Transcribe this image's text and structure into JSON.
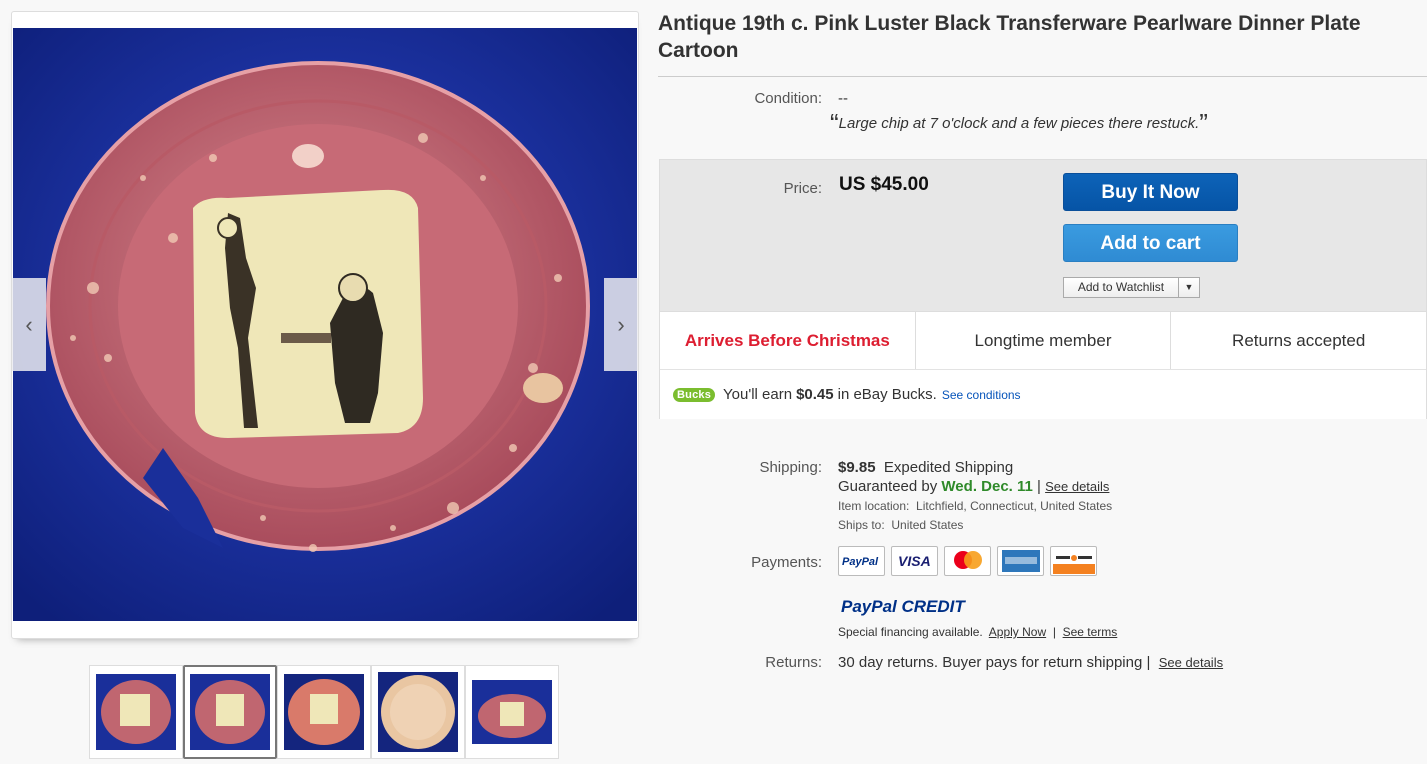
{
  "listing": {
    "title": "Antique 19th c. Pink Luster Black Transferware Pearlware Dinner Plate Cartoon"
  },
  "viewer": {
    "prev_arrow": "‹",
    "next_arrow": "›",
    "thumbnail_count": 5,
    "active_thumbnail": 2
  },
  "condition": {
    "label": "Condition:",
    "value": "--",
    "quote_open": "“",
    "note": "Large chip at 7 o'clock and a few pieces there restuck.",
    "quote_close": "”"
  },
  "buybox": {
    "price_label": "Price:",
    "price": "US $45.00",
    "buy_now": "Buy It Now",
    "add_to_cart": "Add to cart",
    "watchlist": "Add to Watchlist",
    "watchlist_arrow": "▼"
  },
  "badges": {
    "arrives": "Arrives Before Christmas",
    "member": "Longtime member",
    "returns": "Returns accepted"
  },
  "bucks": {
    "logo": "Bucks",
    "prefix": "You'll earn",
    "amount": "$0.45",
    "suffix": "in eBay Bucks.",
    "link": "See conditions"
  },
  "shipping": {
    "label": "Shipping:",
    "cost": "$9.85",
    "method": "Expedited Shipping",
    "guaranteed_prefix": "Guaranteed by",
    "guaranteed_date": "Wed. Dec. 11",
    "separator": "|",
    "details_link": "See details",
    "location_label": "Item location:",
    "location": "Litchfield, Connecticut, United States",
    "ships_to_label": "Ships to:",
    "ships_to": "United States"
  },
  "payments": {
    "label": "Payments:",
    "cards": [
      "PayPal",
      "VISA",
      "Mastercard",
      "American Express",
      "Discover"
    ],
    "paypal_credit_a": "PayPal",
    "paypal_credit_b": "CREDIT",
    "financing": "Special financing available.",
    "apply_now": "Apply Now",
    "separator": "|",
    "see_terms": "See terms"
  },
  "returns": {
    "label": "Returns:",
    "value": "30 day returns. Buyer pays for return shipping",
    "separator": "|",
    "details_link": "See details"
  },
  "colors": {
    "buy_now": "#0654a6",
    "add_to_cart": "#3a9be0",
    "arrives_red": "#dd1e31",
    "guaranteed_green": "#2f8a2a",
    "bucks_green": "#7bbd2f",
    "plate_background": "#1a2f9a",
    "plate_rim": "#c06670"
  }
}
